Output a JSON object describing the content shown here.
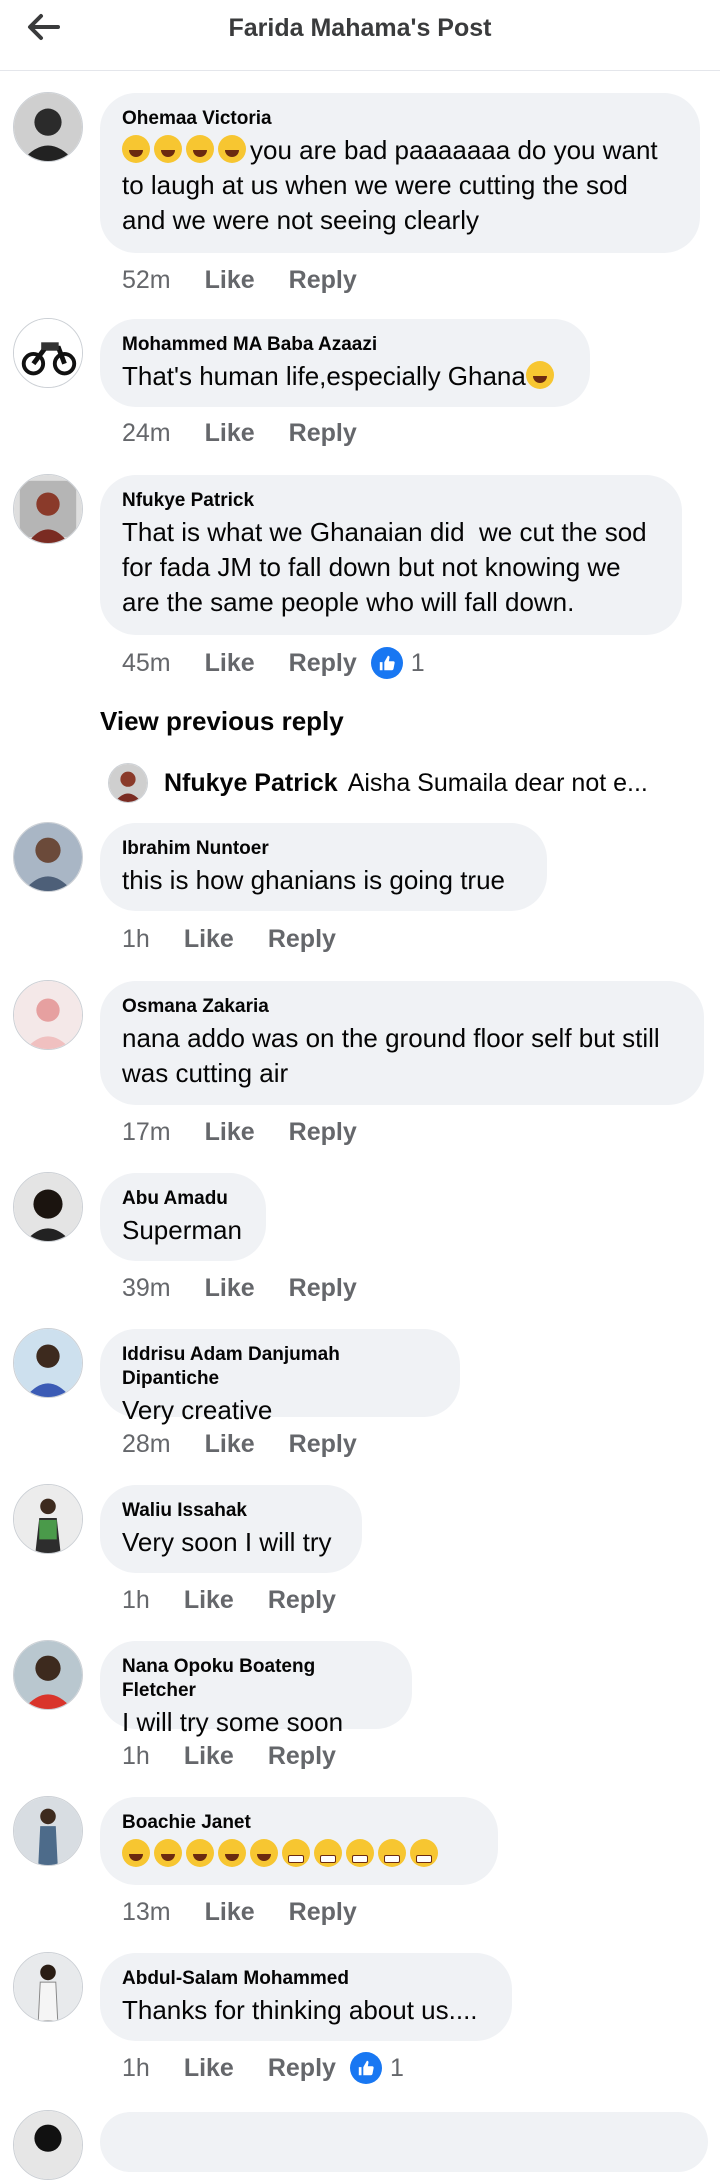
{
  "header": {
    "title": "Farida Mahama's Post",
    "back_icon": "arrow-left-icon"
  },
  "comments": [
    {
      "author": "Ohemaa Victoria",
      "emoji_prefix": "😂😂😂😂",
      "text": "you are bad paaaaaaa do you want to laugh at us when we were cutting the sod and we were not seeing clearly",
      "time": "52m",
      "like": "Like",
      "reply": "Reply"
    },
    {
      "author": "Mohammed MA Baba Azaazi",
      "text": "That's human life,especially Ghana",
      "emoji_suffix": "😂",
      "time": "24m",
      "like": "Like",
      "reply": "Reply"
    },
    {
      "author": "Nfukye Patrick",
      "text": "That is what we Ghanaian did  we cut the sod for fada JM to fall down but not knowing we are the same people who will fall down.",
      "time": "45m",
      "like": "Like",
      "reply": "Reply",
      "reactions": "1"
    },
    {
      "author": "Ibrahim Nuntoer",
      "text": "this is how ghanians is going true",
      "time": "1h",
      "like": "Like",
      "reply": "Reply"
    },
    {
      "author": "Osmana Zakaria",
      "text": "nana addo was on the ground floor self but still was cutting air",
      "time": "17m",
      "like": "Like",
      "reply": "Reply"
    },
    {
      "author": "Abu Amadu",
      "text": "Superman",
      "time": "39m",
      "like": "Like",
      "reply": "Reply"
    },
    {
      "author": "Iddrisu Adam Danjumah Dipantiche",
      "text": "Very creative",
      "time": "28m",
      "like": "Like",
      "reply": "Reply"
    },
    {
      "author": "Waliu Issahak",
      "text": "Very soon I will try",
      "time": "1h",
      "like": "Like",
      "reply": "Reply"
    },
    {
      "author": "Nana Opoku Boateng Fletcher",
      "text": "I will try some soon",
      "time": "1h",
      "like": "Like",
      "reply": "Reply"
    },
    {
      "author": "Boachie Janet",
      "text": "🤣🤣🤣🤣🤣😬😬😬😬😬",
      "time": "13m",
      "like": "Like",
      "reply": "Reply"
    },
    {
      "author": "Abdul-Salam Mohammed",
      "text": "Thanks for thinking about us....",
      "time": "1h",
      "like": "Like",
      "reply": "Reply",
      "reactions": "1"
    }
  ],
  "view_previous": "View previous reply",
  "reply_preview": {
    "author": "Nfukye Patrick",
    "text": "Aisha Sumaila dear not e..."
  },
  "colors": {
    "bubble": "#f0f2f5",
    "like_blue": "#1877f2",
    "meta": "#65676b"
  }
}
